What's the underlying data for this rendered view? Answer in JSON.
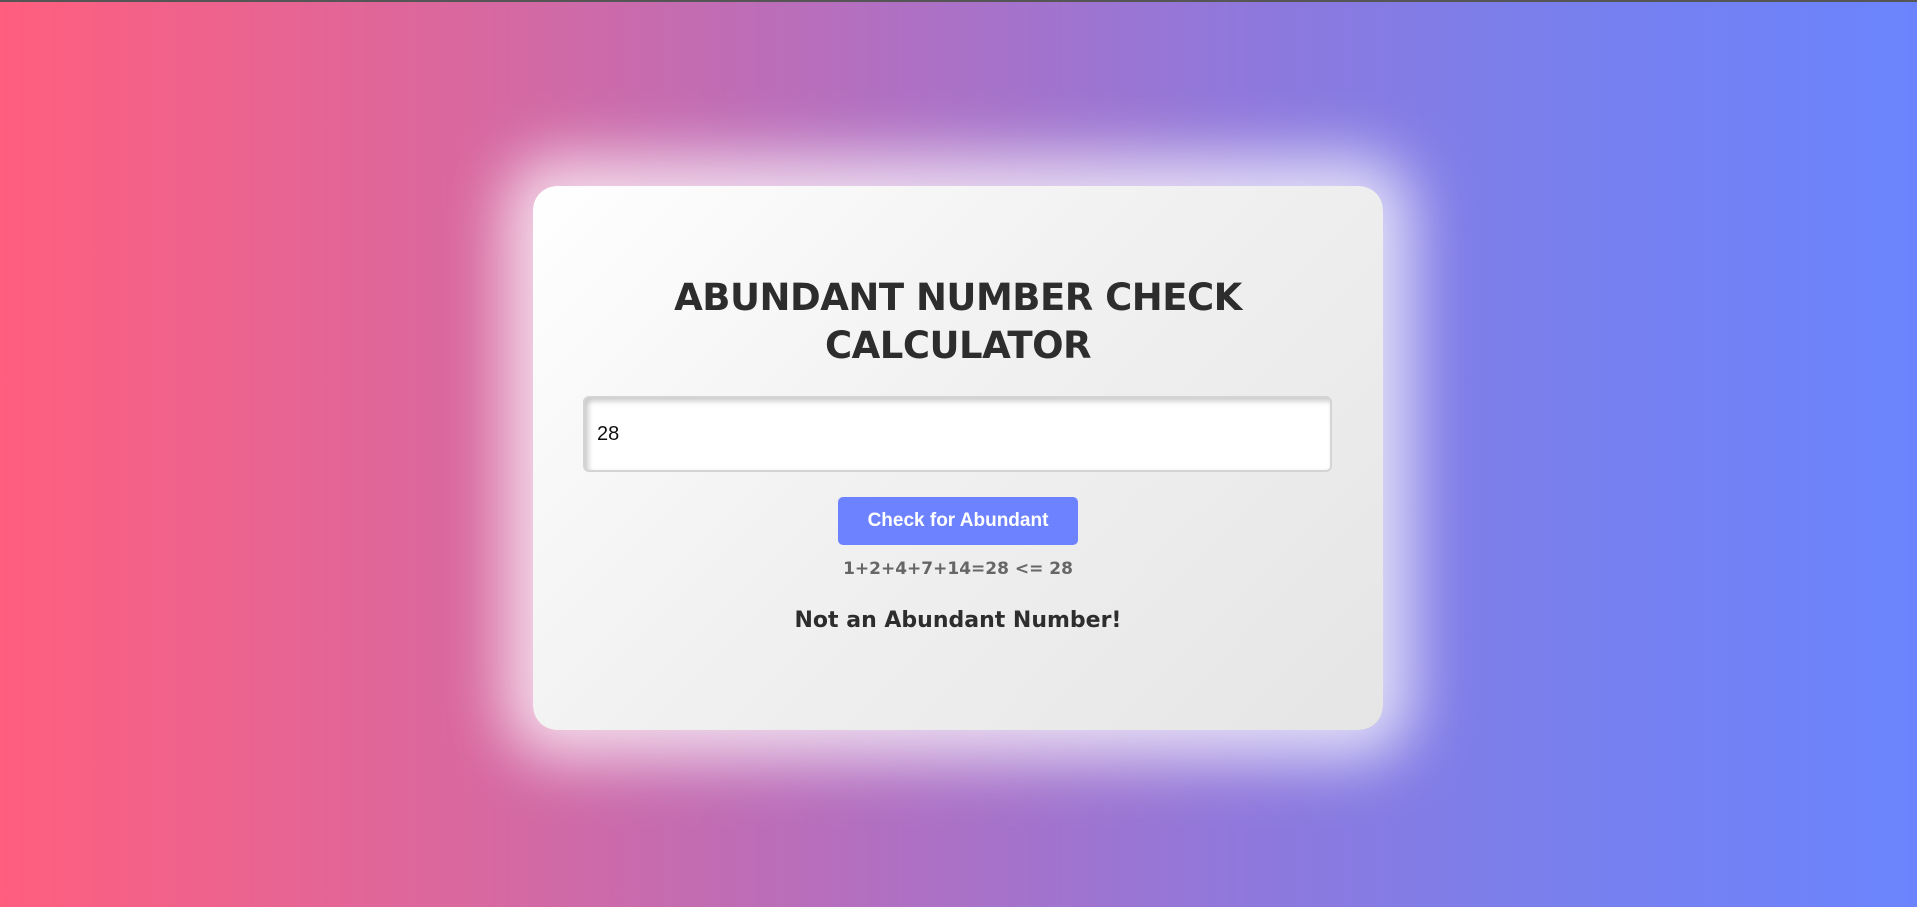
{
  "calculator": {
    "title_line1": "ABUNDANT NUMBER CHECK",
    "title_line2": "CALCULATOR",
    "input_value": "28",
    "button_label": "Check for Abundant",
    "divisor_sum": "1+2+4+7+14=28 <= 28",
    "result_message": "Not an Abundant Number!"
  },
  "colors": {
    "button": "#6d82ff",
    "title_text": "#2d2d2d",
    "sum_text": "#666666",
    "gradient_left": "#ff5e7e",
    "gradient_right": "#6b84fd"
  }
}
